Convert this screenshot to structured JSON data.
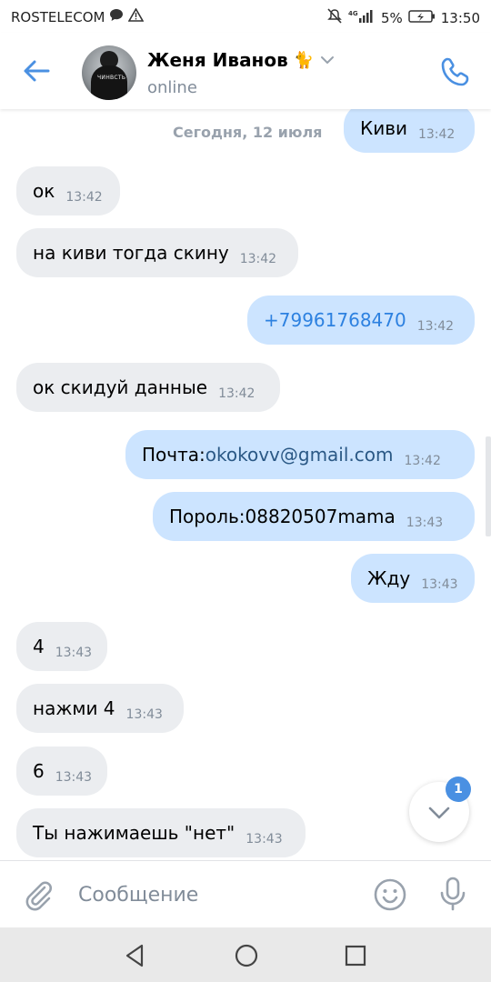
{
  "status_bar": {
    "carrier": "ROSTELECOM",
    "network": "4G",
    "battery": "5%",
    "time": "13:50",
    "left_icons": [
      "chat-bubble-icon",
      "warning-icon"
    ],
    "right_icons": [
      "mute-icon",
      "signal-icon",
      "battery-icon"
    ]
  },
  "header": {
    "contact_name": "Женя Иванов",
    "contact_emoji": "🐈",
    "status": "online",
    "avatar_print": "ЧИНВСТЬ",
    "icons": [
      "back-arrow-icon",
      "chevron-down-icon",
      "phone-icon"
    ]
  },
  "chat": {
    "date_separator": "Сегодня, 12 июля",
    "messages": [
      {
        "direction": "out",
        "text": "Киви",
        "time": "13:42"
      },
      {
        "direction": "in",
        "text": "ок",
        "time": "13:42"
      },
      {
        "direction": "in",
        "text": "на киви тогда скину",
        "time": "13:42"
      },
      {
        "direction": "out",
        "text": "+79961768470",
        "time": "13:42",
        "style": "phone"
      },
      {
        "direction": "in",
        "text": "ок скидуй данные",
        "time": "13:42"
      },
      {
        "direction": "out",
        "text_prefix": "Почта:",
        "link": "okokovv@gmail.com",
        "time": "13:42"
      },
      {
        "direction": "out",
        "text": "Пороль:08820507mama",
        "time": "13:43"
      },
      {
        "direction": "out",
        "text": "Жду",
        "time": "13:43"
      },
      {
        "direction": "in",
        "text": "4",
        "time": "13:43"
      },
      {
        "direction": "in",
        "text": "нажми 4",
        "time": "13:43"
      },
      {
        "direction": "in",
        "text": "6",
        "time": "13:43"
      },
      {
        "direction": "in",
        "text": "Ты нажимаешь \"нет\"",
        "time": "13:43"
      }
    ]
  },
  "scroll_button": {
    "badge": "1",
    "icon": "chevron-down-icon"
  },
  "composer": {
    "placeholder": "Сообщение",
    "value": "",
    "icons": [
      "paperclip-icon",
      "smiley-icon",
      "microphone-icon"
    ]
  },
  "nav_bar": {
    "icons": [
      "nav-back-icon",
      "nav-home-icon",
      "nav-recent-icon"
    ]
  },
  "colors": {
    "accent": "#4a90e2",
    "incoming_bubble": "#ebedf0",
    "outgoing_bubble": "#cce4ff",
    "secondary_text": "#818c99"
  }
}
